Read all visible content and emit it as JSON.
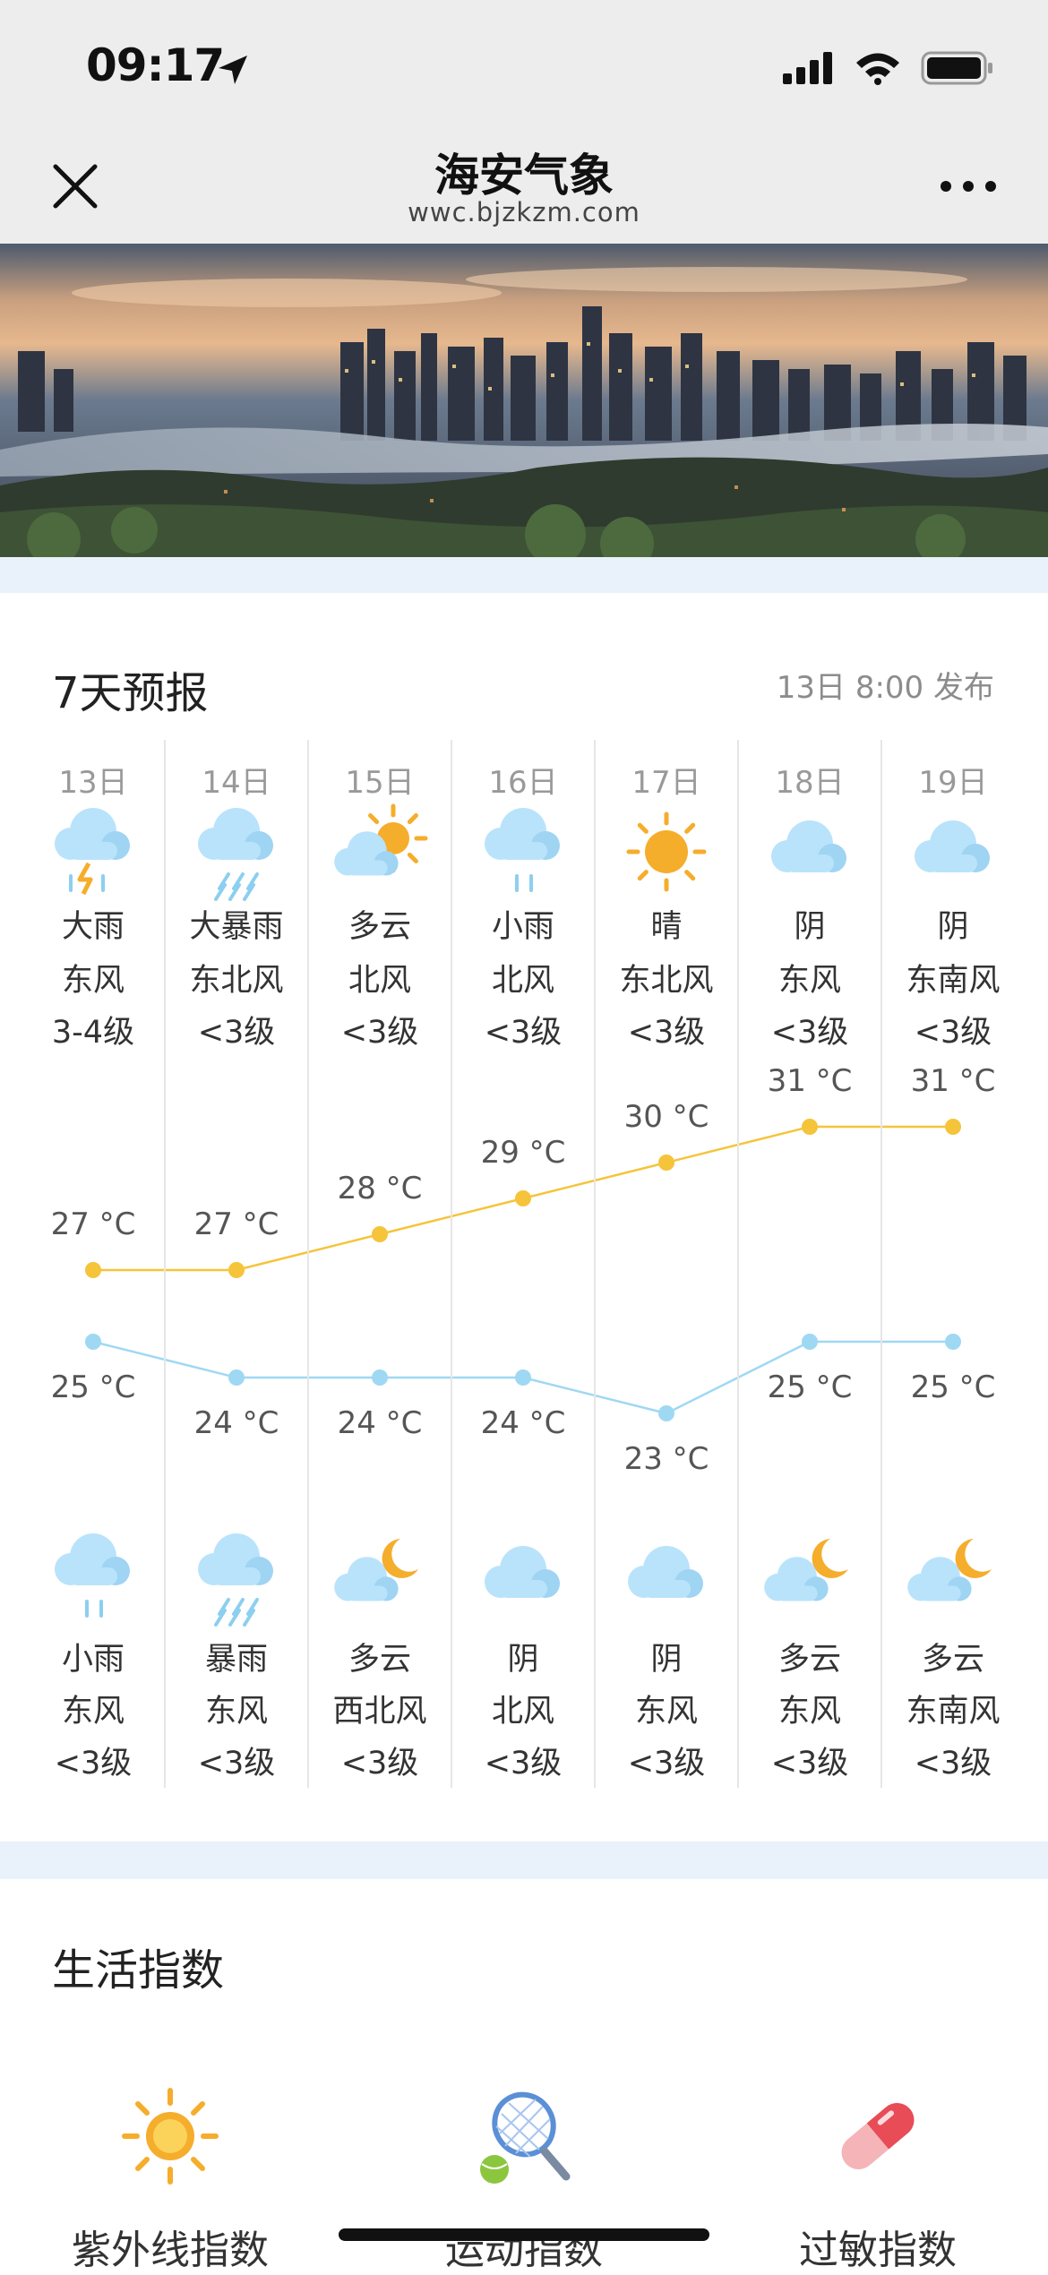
{
  "status": {
    "time": "09:17"
  },
  "header": {
    "title": "海安气象",
    "subtitle": "wwc.bjzkzm.com"
  },
  "forecast": {
    "title": "7天预报",
    "publish": "13日 8:00 发布",
    "days": [
      {
        "date": "13日",
        "day_icon": "thunder-rain-icon",
        "day_weather": "大雨",
        "day_wind": "东风",
        "day_level": "3-4级",
        "night_icon": "rain-icon",
        "night_weather": "小雨",
        "night_wind": "东风",
        "night_level": "<3级"
      },
      {
        "date": "14日",
        "day_icon": "heavy-rain-icon",
        "day_weather": "大暴雨",
        "day_wind": "东北风",
        "day_level": "<3级",
        "night_icon": "heavy-rain-icon",
        "night_weather": "暴雨",
        "night_wind": "东风",
        "night_level": "<3级"
      },
      {
        "date": "15日",
        "day_icon": "partly-cloudy-sun-icon",
        "day_weather": "多云",
        "day_wind": "北风",
        "day_level": "<3级",
        "night_icon": "partly-cloudy-moon-icon",
        "night_weather": "多云",
        "night_wind": "西北风",
        "night_level": "<3级"
      },
      {
        "date": "16日",
        "day_icon": "rain-icon",
        "day_weather": "小雨",
        "day_wind": "北风",
        "day_level": "<3级",
        "night_icon": "cloud-icon",
        "night_weather": "阴",
        "night_wind": "北风",
        "night_level": "<3级"
      },
      {
        "date": "17日",
        "day_icon": "sun-icon",
        "day_weather": "晴",
        "day_wind": "东北风",
        "day_level": "<3级",
        "night_icon": "cloud-icon",
        "night_weather": "阴",
        "night_wind": "东风",
        "night_level": "<3级"
      },
      {
        "date": "18日",
        "day_icon": "cloud-icon",
        "day_weather": "阴",
        "day_wind": "东风",
        "day_level": "<3级",
        "night_icon": "partly-cloudy-moon-icon",
        "night_weather": "多云",
        "night_wind": "东风",
        "night_level": "<3级"
      },
      {
        "date": "19日",
        "day_icon": "cloud-icon",
        "day_weather": "阴",
        "day_wind": "东南风",
        "day_level": "<3级",
        "night_icon": "partly-cloudy-moon-icon",
        "night_weather": "多云",
        "night_wind": "东南风",
        "night_level": "<3级"
      }
    ]
  },
  "chart_data": {
    "type": "line",
    "categories": [
      "13日",
      "14日",
      "15日",
      "16日",
      "17日",
      "18日",
      "19日"
    ],
    "series": [
      {
        "values": [
          27,
          27,
          28,
          29,
          30,
          31,
          31
        ],
        "color": "#f5c43a"
      },
      {
        "values": [
          25,
          24,
          24,
          24,
          23,
          25,
          25
        ],
        "color": "#9fd8f3"
      }
    ],
    "unit": "°C"
  },
  "life": {
    "title": "生活指数",
    "items": [
      {
        "label": "紫外线指数",
        "icon": "sun-icon"
      },
      {
        "label": "运动指数",
        "icon": "tennis-racket-icon"
      },
      {
        "label": "过敏指数",
        "icon": "pill-icon"
      }
    ]
  },
  "colors": {
    "sun": "#f5ad2c",
    "cloud": "#b9e3fb",
    "high_line": "#f5c43a",
    "low_line": "#9fd8f3"
  }
}
